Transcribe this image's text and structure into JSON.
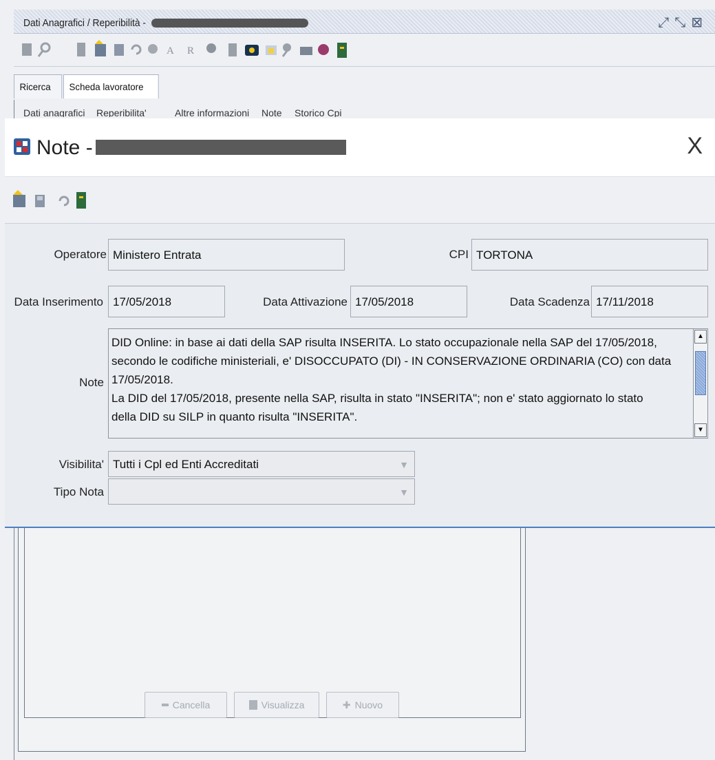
{
  "background_window": {
    "title_prefix": "Dati Anagrafici / Reperibilità -",
    "tabs_top": [
      "Ricerca",
      "Scheda lavoratore"
    ],
    "tabs_sub": [
      "Dati anagrafici",
      "Reperibilita'",
      "Altre informazioni",
      "Note",
      "Storico Cpi"
    ],
    "buttons": {
      "cancella": "Cancella",
      "visualizza": "Visualizza",
      "nuovo": "Nuovo"
    }
  },
  "dialog": {
    "title_prefix": "Note -",
    "close_glyph": "X",
    "fields": {
      "operatore_label": "Operatore",
      "operatore_value": "Ministero Entrata",
      "cpi_label": "CPI",
      "cpi_value": "TORTONA",
      "data_inserimento_label": "Data Inserimento",
      "data_inserimento_value": "17/05/2018",
      "data_attivazione_label": "Data Attivazione",
      "data_attivazione_value": "17/05/2018",
      "data_scadenza_label": "Data Scadenza",
      "data_scadenza_value": "17/11/2018",
      "note_label": "Note",
      "note_value": "DID Online: in base ai dati della SAP risulta INSERITA. Lo stato occupazionale nella SAP del 17/05/2018,\nsecondo le codifiche ministeriali, e' DISOCCUPATO (DI) - IN CONSERVAZIONE ORDINARIA (CO) con data\n17/05/2018.\nLa DID del 17/05/2018, presente nella SAP, risulta in stato \"INSERITA\"; non e' stato aggiornato lo stato\ndella DID su SILP in quanto risulta \"INSERITA\".",
      "visibilita_label": "Visibilita'",
      "visibilita_value": "Tutti i Cpl ed Enti Accreditati",
      "tipo_nota_label": "Tipo Nota",
      "tipo_nota_value": ""
    }
  },
  "colors": {
    "accent": "#4b7fc2",
    "panel": "#e9ecf1"
  }
}
